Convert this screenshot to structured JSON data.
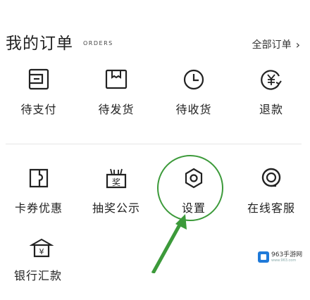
{
  "header": {
    "title": "我的订单",
    "subtitle": "ORDERS",
    "all_orders": "全部订单"
  },
  "orders": [
    {
      "label": "待支付",
      "icon": "wallet-icon"
    },
    {
      "label": "待发货",
      "icon": "package-icon"
    },
    {
      "label": "待收货",
      "icon": "clock-icon"
    },
    {
      "label": "退款",
      "icon": "refund-yen-icon"
    }
  ],
  "services": [
    {
      "label": "卡券优惠",
      "icon": "coupon-icon"
    },
    {
      "label": "抽奖公示",
      "icon": "lottery-icon",
      "icon_text": "奖"
    },
    {
      "label": "设置",
      "icon": "settings-hexagon-icon"
    },
    {
      "label": "在线客服",
      "icon": "customer-service-icon"
    }
  ],
  "extra": {
    "label": "银行汇款",
    "icon": "bank-yen-icon",
    "icon_text": "¥"
  },
  "watermark": {
    "text": "963手游网",
    "sub": "www.963.com"
  },
  "colors": {
    "annotation_green": "#3c9a3a",
    "watermark_blue": "#1f7ad9"
  }
}
